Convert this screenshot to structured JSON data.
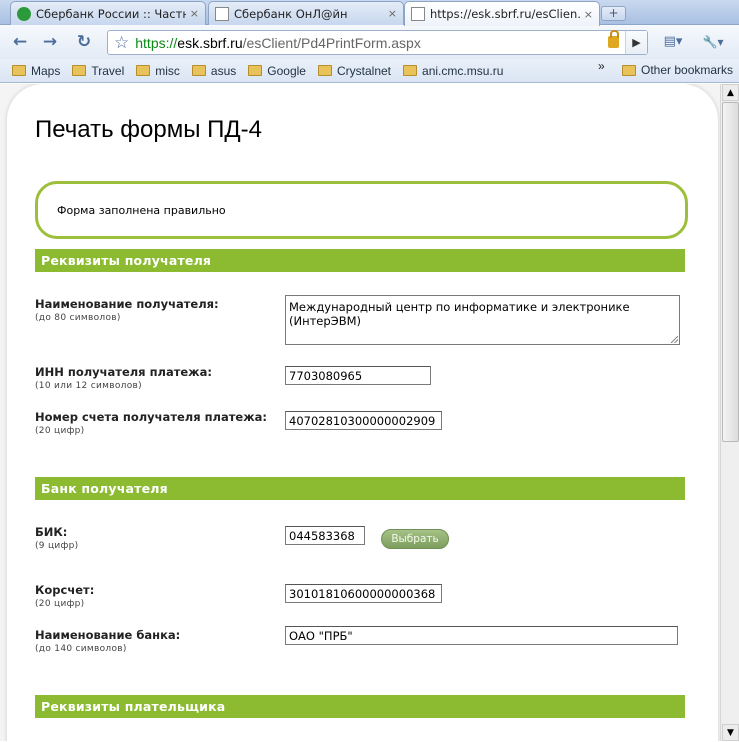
{
  "tabs": [
    {
      "title": "Сбербанк России :: Частн…",
      "close": "×",
      "active": false
    },
    {
      "title": "Сбербанк ОнЛ@йн",
      "close": "×",
      "active": false
    },
    {
      "title": "https://esk.sbrf.ru/esClien…",
      "close": "×",
      "active": true
    }
  ],
  "newtab_label": "+",
  "toolbar": {
    "back": "←",
    "forward": "→",
    "reload": "↻",
    "star": "☆",
    "url_scheme": "https://",
    "url_host": "esk.sbrf.ru",
    "url_path": "/esClient/Pd4PrintForm.aspx",
    "go": "▶",
    "page_menu": "▤▾",
    "tools_menu": "🔧▾"
  },
  "bookmarks": {
    "items": [
      "Maps",
      "Travel",
      "misc",
      "asus",
      "Google",
      "Crystalnet",
      "ani.cmc.msu.ru"
    ],
    "overflow": "»",
    "other": "Other bookmarks"
  },
  "page": {
    "title": "Печать формы ПД-4",
    "message": "Форма заполнена правильно",
    "sections": {
      "recipient": "Реквизиты получателя",
      "bank": "Банк получателя",
      "payer": "Реквизиты плательщика"
    },
    "fields": {
      "recipient_name": {
        "label": "Наименование получателя:",
        "hint": "(до 80 символов)",
        "value": "Международный центр по информатике и электронике (ИнтерЭВМ)"
      },
      "inn": {
        "label": "ИНН получателя платежа:",
        "hint": "(10 или 12 символов)",
        "value": "7703080965"
      },
      "account": {
        "label": "Номер счета получателя платежа:",
        "hint": "(20 цифр)",
        "value": "40702810300000002909"
      },
      "bik": {
        "label": "БИК:",
        "hint": "(9 цифр)",
        "value": "044583368"
      },
      "corr_account": {
        "label": "Корсчет:",
        "hint": "(20 цифр)",
        "value": "30101810600000000368"
      },
      "bank_name": {
        "label": "Наименование банка:",
        "hint": "(до 140 символов)",
        "value": "ОАО \"ПРБ\""
      }
    },
    "select_button": "Выбрать"
  },
  "scrollbar": {
    "up": "▲",
    "down": "▼"
  }
}
